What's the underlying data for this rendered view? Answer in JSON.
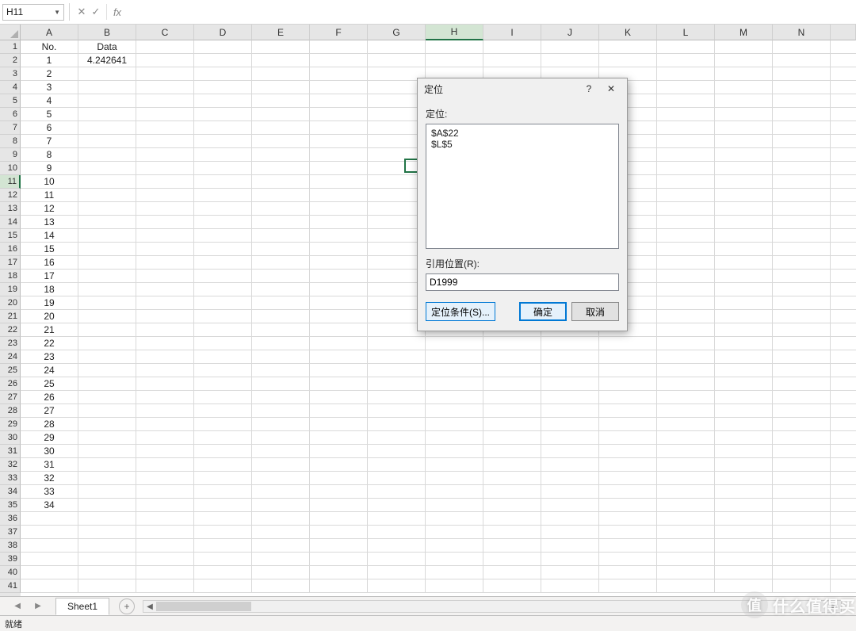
{
  "formula_bar": {
    "name_box": "H11",
    "formula": ""
  },
  "columns": [
    "A",
    "B",
    "C",
    "D",
    "E",
    "F",
    "G",
    "H",
    "I",
    "J",
    "K",
    "L",
    "M",
    "N"
  ],
  "selected_col_index": 7,
  "selected_row_index": 10,
  "row_count": 41,
  "data": {
    "A1": "No.",
    "B1": "Data",
    "B2": "4.242641",
    "A_numbers_start": 1,
    "A_numbers_end": 34
  },
  "dialog": {
    "title": "定位",
    "goto_label": "定位:",
    "goto_items": [
      "$A$22",
      "$L$5"
    ],
    "reference_label": "引用位置(R):",
    "reference_value": "D1999",
    "special_button": "定位条件(S)...",
    "ok_button": "确定",
    "cancel_button": "取消",
    "help_symbol": "?",
    "close_symbol": "✕"
  },
  "sheet_tabs": {
    "active": "Sheet1",
    "add_symbol": "+"
  },
  "status_bar": {
    "text": "就绪"
  },
  "watermark": {
    "badge": "值",
    "text": "什么值得买"
  }
}
